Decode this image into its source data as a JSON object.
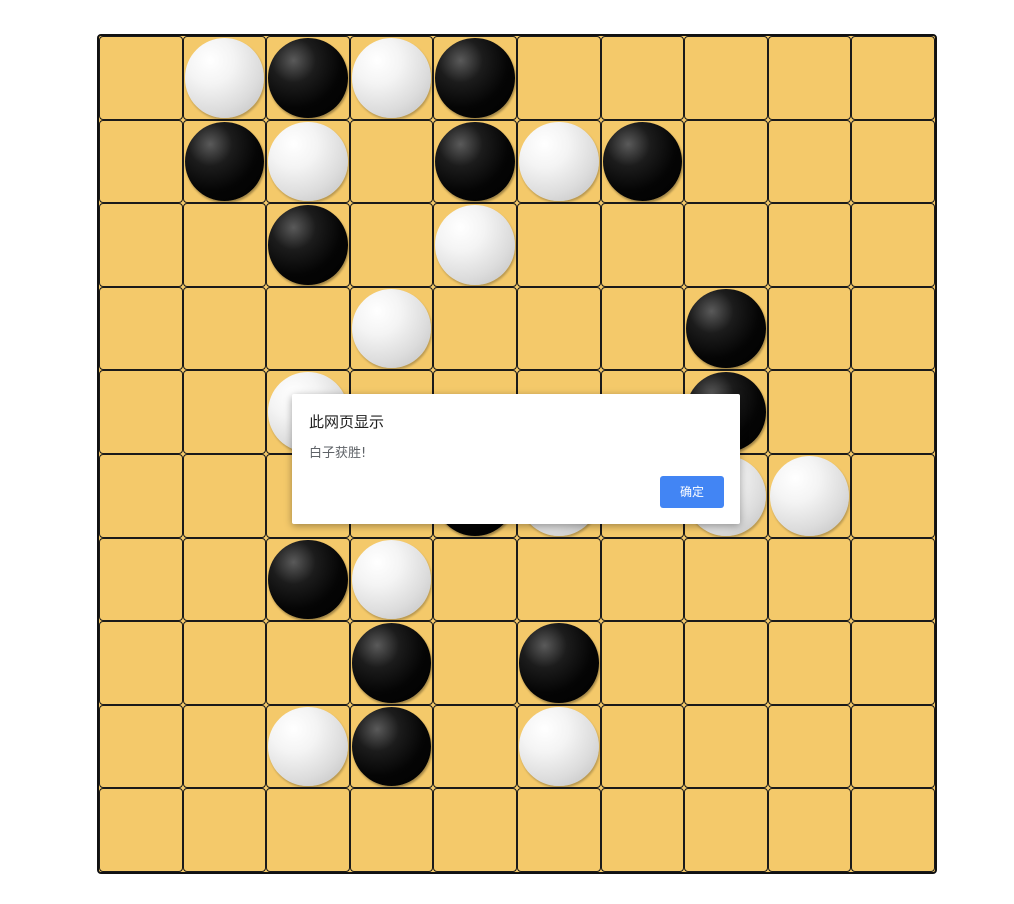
{
  "board": {
    "size": 10,
    "stones": [
      {
        "row": 0,
        "col": 1,
        "color": "white"
      },
      {
        "row": 0,
        "col": 2,
        "color": "black"
      },
      {
        "row": 0,
        "col": 3,
        "color": "white"
      },
      {
        "row": 0,
        "col": 4,
        "color": "black"
      },
      {
        "row": 1,
        "col": 1,
        "color": "black"
      },
      {
        "row": 1,
        "col": 2,
        "color": "white"
      },
      {
        "row": 1,
        "col": 4,
        "color": "black"
      },
      {
        "row": 1,
        "col": 5,
        "color": "white"
      },
      {
        "row": 1,
        "col": 6,
        "color": "black"
      },
      {
        "row": 2,
        "col": 2,
        "color": "black"
      },
      {
        "row": 2,
        "col": 4,
        "color": "white"
      },
      {
        "row": 3,
        "col": 3,
        "color": "white"
      },
      {
        "row": 3,
        "col": 7,
        "color": "black"
      },
      {
        "row": 4,
        "col": 2,
        "color": "white"
      },
      {
        "row": 4,
        "col": 7,
        "color": "black"
      },
      {
        "row": 5,
        "col": 4,
        "color": "black"
      },
      {
        "row": 5,
        "col": 5,
        "color": "white"
      },
      {
        "row": 5,
        "col": 7,
        "color": "white"
      },
      {
        "row": 5,
        "col": 8,
        "color": "white"
      },
      {
        "row": 6,
        "col": 2,
        "color": "black"
      },
      {
        "row": 6,
        "col": 3,
        "color": "white"
      },
      {
        "row": 7,
        "col": 3,
        "color": "black"
      },
      {
        "row": 7,
        "col": 5,
        "color": "black"
      },
      {
        "row": 8,
        "col": 2,
        "color": "white"
      },
      {
        "row": 8,
        "col": 3,
        "color": "black"
      },
      {
        "row": 8,
        "col": 5,
        "color": "white"
      }
    ]
  },
  "dialog": {
    "title": "此网页显示",
    "message": "白子获胜!",
    "ok_label": "确定"
  },
  "colors": {
    "board": "#f4c96a",
    "grid_line": "#1a1a1a",
    "button": "#4285f4"
  }
}
